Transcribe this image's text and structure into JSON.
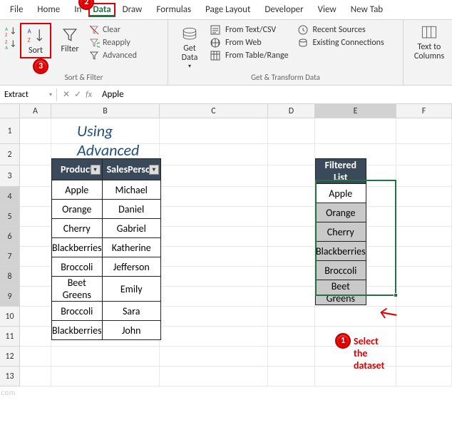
{
  "tabs": [
    "File",
    "Home",
    "In",
    "Data",
    "Draw",
    "Formulas",
    "Page Layout",
    "Developer",
    "View",
    "New Tab"
  ],
  "active_tab": "Data",
  "ribbon": {
    "sort_filter_label": "Sort & Filter",
    "sort_label": "Sort",
    "filter_label": "Filter",
    "clear": "Clear",
    "reapply": "Reapply",
    "advanced": "Advanced",
    "get_transform_label": "Get & Transform Data",
    "get_data": "Get\nData",
    "from_text": "From Text/CSV",
    "from_web": "From Web",
    "from_table": "From Table/Range",
    "recent": "Recent Sources",
    "existing": "Existing Connections",
    "text_to_cols": "Text to\nColumns"
  },
  "namebox": "Extract",
  "formula": "Apple",
  "columns": [
    "A",
    "B",
    "C",
    "D",
    "E",
    "F"
  ],
  "title": "Using Advanced Filter Option",
  "table": {
    "h1": "Product",
    "h2": "SalesPerson",
    "rows": [
      {
        "p": "Apple",
        "s": "Michael"
      },
      {
        "p": "Orange",
        "s": "Daniel"
      },
      {
        "p": "Cherry",
        "s": "Gabriel"
      },
      {
        "p": "Blackberries",
        "s": "Katherine"
      },
      {
        "p": "Broccoli",
        "s": "Jefferson"
      },
      {
        "p": "Beet Greens",
        "s": "Emily"
      },
      {
        "p": "Broccoli",
        "s": "Sara"
      },
      {
        "p": "Blackberries",
        "s": "John"
      }
    ]
  },
  "filtered": {
    "header": "Filtered List",
    "items": [
      "Apple",
      "Orange",
      "Cherry",
      "Blackberries",
      "Broccoli",
      "Beet Greens"
    ]
  },
  "badges": {
    "b1": "1",
    "b2": "2",
    "b3": "3"
  },
  "annotation": "Select the dataset",
  "watermark": "wsxdn.com"
}
